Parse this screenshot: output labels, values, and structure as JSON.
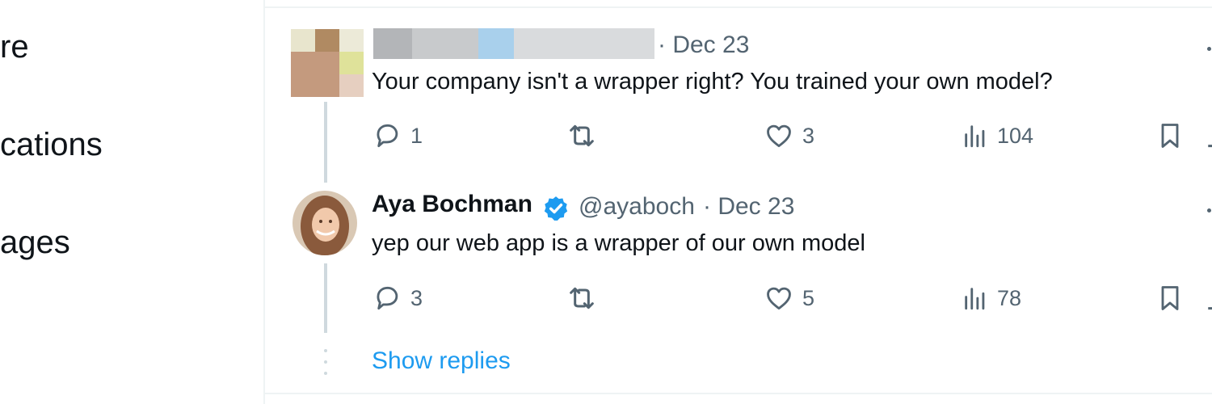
{
  "sidebar": {
    "items": [
      {
        "label": "re"
      },
      {
        "label": "cations"
      },
      {
        "label": "ages"
      }
    ]
  },
  "tweets": [
    {
      "date": "· Dec 23",
      "text": "Your company isn't a wrapper right? You trained your own model?",
      "actions": {
        "replies": "1",
        "retweets": "",
        "likes": "3",
        "views": "104"
      }
    },
    {
      "display_name": "Aya Bochman",
      "handle": "@ayaboch",
      "date": "· Dec 23",
      "text": "yep our web app is a wrapper of our own model",
      "actions": {
        "replies": "3",
        "retweets": "",
        "likes": "5",
        "views": "78"
      }
    }
  ],
  "show_replies": "Show replies",
  "colors": {
    "accent": "#1d9bf0",
    "muted_text": "#536471",
    "text": "#0f1419",
    "thread_line": "#cfd9de"
  },
  "icons": [
    "reply-icon",
    "retweet-icon",
    "like-icon",
    "views-icon",
    "bookmark-icon",
    "share-icon",
    "verified-badge-icon",
    "more-icon"
  ]
}
